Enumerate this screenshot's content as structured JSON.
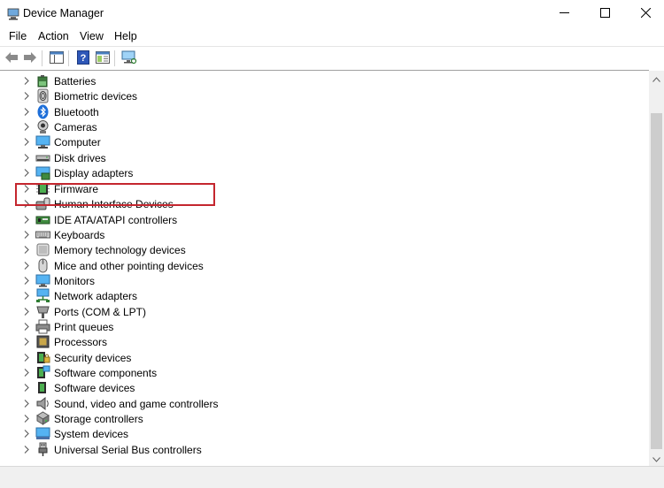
{
  "window": {
    "title": "Device Manager",
    "controls": {
      "minimize_icon": "minimize-icon",
      "maximize_icon": "maximize-icon",
      "close_icon": "close-icon"
    }
  },
  "menu": {
    "items": [
      {
        "label": "File"
      },
      {
        "label": "Action"
      },
      {
        "label": "View"
      },
      {
        "label": "Help"
      }
    ]
  },
  "toolbar": {
    "buttons": [
      {
        "icon": "back-arrow-icon"
      },
      {
        "icon": "forward-arrow-icon"
      },
      {
        "icon": "show-hide-console-tree-icon"
      },
      {
        "icon": "help-icon"
      },
      {
        "icon": "properties-icon"
      },
      {
        "icon": "scan-hardware-changes-icon"
      }
    ]
  },
  "tree": {
    "highlighted_item": "Mice and other pointing devices",
    "highlight_color": "#c4262e",
    "items": [
      {
        "label": "Batteries",
        "icon": "battery-icon"
      },
      {
        "label": "Biometric devices",
        "icon": "fingerprint-icon"
      },
      {
        "label": "Bluetooth",
        "icon": "bluetooth-icon"
      },
      {
        "label": "Cameras",
        "icon": "camera-icon"
      },
      {
        "label": "Computer",
        "icon": "computer-icon"
      },
      {
        "label": "Disk drives",
        "icon": "disk-drive-icon"
      },
      {
        "label": "Display adapters",
        "icon": "display-adapter-icon"
      },
      {
        "label": "Firmware",
        "icon": "firmware-chip-icon"
      },
      {
        "label": "Human Interface Devices",
        "icon": "hid-icon"
      },
      {
        "label": "IDE ATA/ATAPI controllers",
        "icon": "ide-controller-icon"
      },
      {
        "label": "Keyboards",
        "icon": "keyboard-icon"
      },
      {
        "label": "Memory technology devices",
        "icon": "memory-device-icon"
      },
      {
        "label": "Mice and other pointing devices",
        "icon": "mouse-icon"
      },
      {
        "label": "Monitors",
        "icon": "monitor-icon"
      },
      {
        "label": "Network adapters",
        "icon": "network-adapter-icon"
      },
      {
        "label": "Ports (COM & LPT)",
        "icon": "port-icon"
      },
      {
        "label": "Print queues",
        "icon": "printer-icon"
      },
      {
        "label": "Processors",
        "icon": "processor-icon"
      },
      {
        "label": "Security devices",
        "icon": "security-device-icon"
      },
      {
        "label": "Software components",
        "icon": "software-component-icon"
      },
      {
        "label": "Software devices",
        "icon": "software-device-icon"
      },
      {
        "label": "Sound, video and game controllers",
        "icon": "speaker-icon"
      },
      {
        "label": "Storage controllers",
        "icon": "storage-controller-icon"
      },
      {
        "label": "System devices",
        "icon": "system-device-icon"
      },
      {
        "label": "Universal Serial Bus controllers",
        "icon": "usb-icon"
      }
    ]
  }
}
